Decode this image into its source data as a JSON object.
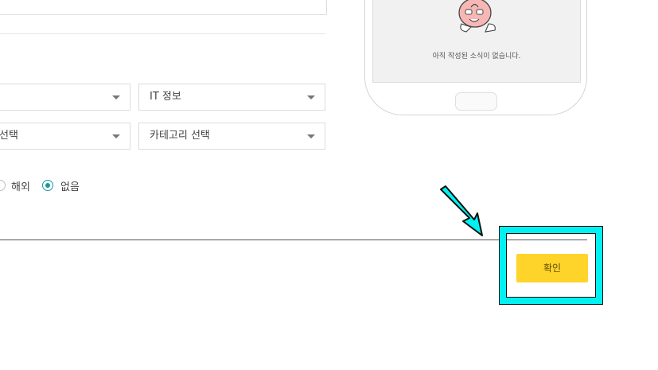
{
  "form": {
    "selects": [
      {
        "value": ""
      },
      {
        "value": "IT 정보"
      },
      {
        "value": "선택"
      },
      {
        "value": "카테고리 선택"
      }
    ],
    "radios": [
      {
        "label": "해외",
        "checked": false
      },
      {
        "label": "없음",
        "checked": true
      }
    ]
  },
  "preview": {
    "empty_message": "아직 작성된 소식이 없습니다."
  },
  "actions": {
    "confirm_label": "확인"
  },
  "annotation": {
    "highlight_color": "#00f1f1",
    "arrow_color": "#00f1f1"
  },
  "colors": {
    "confirm_button": "#ffd42a",
    "radio_checked": "#1a9aa0"
  }
}
